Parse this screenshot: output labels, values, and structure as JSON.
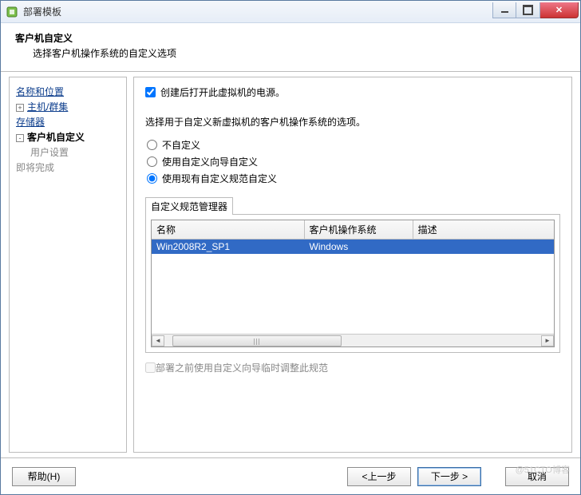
{
  "window": {
    "title": "部署模板"
  },
  "header": {
    "title": "客户机自定义",
    "subtitle": "选择客户机操作系统的自定义选项"
  },
  "sidebar": {
    "items": [
      {
        "label": "名称和位置",
        "type": "link",
        "toggle": ""
      },
      {
        "label": "主机/群集",
        "type": "link",
        "toggle": "+"
      },
      {
        "label": "存储器",
        "type": "link",
        "toggle": ""
      },
      {
        "label": "客户机自定义",
        "type": "current",
        "toggle": "-"
      },
      {
        "label": "用户设置",
        "type": "disabled-indent",
        "toggle": ""
      },
      {
        "label": "即将完成",
        "type": "disabled",
        "toggle": ""
      }
    ]
  },
  "main": {
    "power_on_label": "创建后打开此虚拟机的电源。",
    "power_on_checked": true,
    "section_prompt": "选择用于自定义新虚拟机的客户机操作系统的选项。",
    "radios": {
      "none": "不自定义",
      "wizard": "使用自定义向导自定义",
      "existing": "使用现有自定义规范自定义"
    },
    "selected_radio": "existing",
    "spec_manager_label": "自定义规范管理器",
    "table": {
      "cols": {
        "name": "名称",
        "os": "客户机操作系统",
        "desc": "描述"
      },
      "rows": [
        {
          "name": "Win2008R2_SP1",
          "os": "Windows",
          "desc": ""
        }
      ]
    },
    "adjust_label": "部署之前使用自定义向导临时调整此规范",
    "adjust_checked": false,
    "adjust_enabled": false
  },
  "footer": {
    "help": "帮助(H)",
    "back": "<上一步",
    "next": "下一步 >",
    "cancel": "取消"
  },
  "watermark": "@51CTO博客"
}
